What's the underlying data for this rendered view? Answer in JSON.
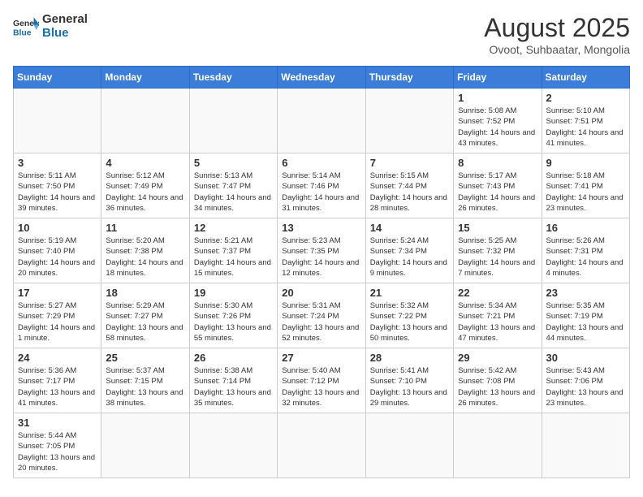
{
  "header": {
    "logo_general": "General",
    "logo_blue": "Blue",
    "title": "August 2025",
    "subtitle": "Ovoot, Suhbaatar, Mongolia"
  },
  "weekdays": [
    "Sunday",
    "Monday",
    "Tuesday",
    "Wednesday",
    "Thursday",
    "Friday",
    "Saturday"
  ],
  "weeks": [
    [
      {
        "day": "",
        "info": ""
      },
      {
        "day": "",
        "info": ""
      },
      {
        "day": "",
        "info": ""
      },
      {
        "day": "",
        "info": ""
      },
      {
        "day": "",
        "info": ""
      },
      {
        "day": "1",
        "info": "Sunrise: 5:08 AM\nSunset: 7:52 PM\nDaylight: 14 hours and 43 minutes."
      },
      {
        "day": "2",
        "info": "Sunrise: 5:10 AM\nSunset: 7:51 PM\nDaylight: 14 hours and 41 minutes."
      }
    ],
    [
      {
        "day": "3",
        "info": "Sunrise: 5:11 AM\nSunset: 7:50 PM\nDaylight: 14 hours and 39 minutes."
      },
      {
        "day": "4",
        "info": "Sunrise: 5:12 AM\nSunset: 7:49 PM\nDaylight: 14 hours and 36 minutes."
      },
      {
        "day": "5",
        "info": "Sunrise: 5:13 AM\nSunset: 7:47 PM\nDaylight: 14 hours and 34 minutes."
      },
      {
        "day": "6",
        "info": "Sunrise: 5:14 AM\nSunset: 7:46 PM\nDaylight: 14 hours and 31 minutes."
      },
      {
        "day": "7",
        "info": "Sunrise: 5:15 AM\nSunset: 7:44 PM\nDaylight: 14 hours and 28 minutes."
      },
      {
        "day": "8",
        "info": "Sunrise: 5:17 AM\nSunset: 7:43 PM\nDaylight: 14 hours and 26 minutes."
      },
      {
        "day": "9",
        "info": "Sunrise: 5:18 AM\nSunset: 7:41 PM\nDaylight: 14 hours and 23 minutes."
      }
    ],
    [
      {
        "day": "10",
        "info": "Sunrise: 5:19 AM\nSunset: 7:40 PM\nDaylight: 14 hours and 20 minutes."
      },
      {
        "day": "11",
        "info": "Sunrise: 5:20 AM\nSunset: 7:38 PM\nDaylight: 14 hours and 18 minutes."
      },
      {
        "day": "12",
        "info": "Sunrise: 5:21 AM\nSunset: 7:37 PM\nDaylight: 14 hours and 15 minutes."
      },
      {
        "day": "13",
        "info": "Sunrise: 5:23 AM\nSunset: 7:35 PM\nDaylight: 14 hours and 12 minutes."
      },
      {
        "day": "14",
        "info": "Sunrise: 5:24 AM\nSunset: 7:34 PM\nDaylight: 14 hours and 9 minutes."
      },
      {
        "day": "15",
        "info": "Sunrise: 5:25 AM\nSunset: 7:32 PM\nDaylight: 14 hours and 7 minutes."
      },
      {
        "day": "16",
        "info": "Sunrise: 5:26 AM\nSunset: 7:31 PM\nDaylight: 14 hours and 4 minutes."
      }
    ],
    [
      {
        "day": "17",
        "info": "Sunrise: 5:27 AM\nSunset: 7:29 PM\nDaylight: 14 hours and 1 minute."
      },
      {
        "day": "18",
        "info": "Sunrise: 5:29 AM\nSunset: 7:27 PM\nDaylight: 13 hours and 58 minutes."
      },
      {
        "day": "19",
        "info": "Sunrise: 5:30 AM\nSunset: 7:26 PM\nDaylight: 13 hours and 55 minutes."
      },
      {
        "day": "20",
        "info": "Sunrise: 5:31 AM\nSunset: 7:24 PM\nDaylight: 13 hours and 52 minutes."
      },
      {
        "day": "21",
        "info": "Sunrise: 5:32 AM\nSunset: 7:22 PM\nDaylight: 13 hours and 50 minutes."
      },
      {
        "day": "22",
        "info": "Sunrise: 5:34 AM\nSunset: 7:21 PM\nDaylight: 13 hours and 47 minutes."
      },
      {
        "day": "23",
        "info": "Sunrise: 5:35 AM\nSunset: 7:19 PM\nDaylight: 13 hours and 44 minutes."
      }
    ],
    [
      {
        "day": "24",
        "info": "Sunrise: 5:36 AM\nSunset: 7:17 PM\nDaylight: 13 hours and 41 minutes."
      },
      {
        "day": "25",
        "info": "Sunrise: 5:37 AM\nSunset: 7:15 PM\nDaylight: 13 hours and 38 minutes."
      },
      {
        "day": "26",
        "info": "Sunrise: 5:38 AM\nSunset: 7:14 PM\nDaylight: 13 hours and 35 minutes."
      },
      {
        "day": "27",
        "info": "Sunrise: 5:40 AM\nSunset: 7:12 PM\nDaylight: 13 hours and 32 minutes."
      },
      {
        "day": "28",
        "info": "Sunrise: 5:41 AM\nSunset: 7:10 PM\nDaylight: 13 hours and 29 minutes."
      },
      {
        "day": "29",
        "info": "Sunrise: 5:42 AM\nSunset: 7:08 PM\nDaylight: 13 hours and 26 minutes."
      },
      {
        "day": "30",
        "info": "Sunrise: 5:43 AM\nSunset: 7:06 PM\nDaylight: 13 hours and 23 minutes."
      }
    ],
    [
      {
        "day": "31",
        "info": "Sunrise: 5:44 AM\nSunset: 7:05 PM\nDaylight: 13 hours and 20 minutes."
      },
      {
        "day": "",
        "info": ""
      },
      {
        "day": "",
        "info": ""
      },
      {
        "day": "",
        "info": ""
      },
      {
        "day": "",
        "info": ""
      },
      {
        "day": "",
        "info": ""
      },
      {
        "day": "",
        "info": ""
      }
    ]
  ]
}
